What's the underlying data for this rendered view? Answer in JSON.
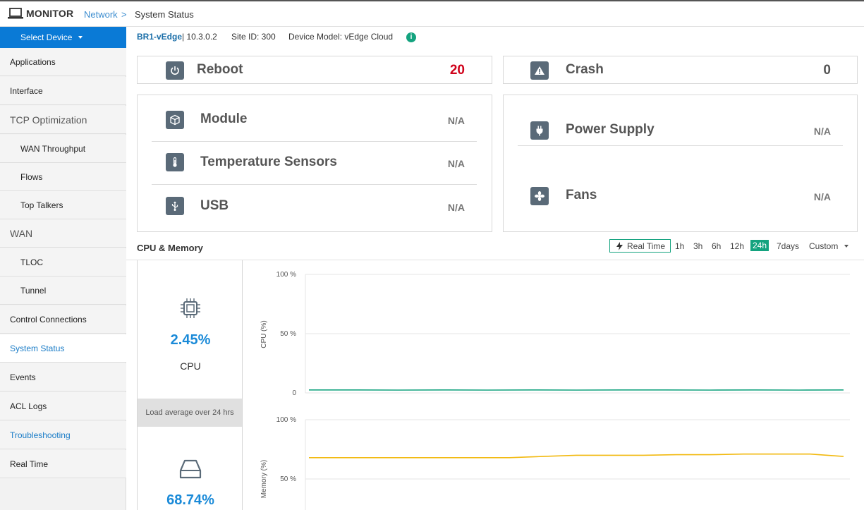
{
  "header": {
    "app_title": "MONITOR",
    "breadcrumb_link": "Network",
    "breadcrumb_sep": ">",
    "breadcrumb_current": "System Status"
  },
  "sidebar": {
    "select_device": "Select Device",
    "items": [
      {
        "label": "Applications",
        "kind": "top"
      },
      {
        "label": "Interface",
        "kind": "top"
      },
      {
        "label": "TCP Optimization",
        "kind": "group"
      },
      {
        "label": "WAN Throughput",
        "kind": "sub"
      },
      {
        "label": "Flows",
        "kind": "sub"
      },
      {
        "label": "Top Talkers",
        "kind": "sub"
      },
      {
        "label": "WAN",
        "kind": "group"
      },
      {
        "label": "TLOC",
        "kind": "sub"
      },
      {
        "label": "Tunnel",
        "kind": "sub"
      },
      {
        "label": "Control Connections",
        "kind": "top"
      },
      {
        "label": "System Status",
        "kind": "top",
        "active": true
      },
      {
        "label": "Events",
        "kind": "top"
      },
      {
        "label": "ACL Logs",
        "kind": "top"
      },
      {
        "label": "Troubleshooting",
        "kind": "top",
        "link": true
      },
      {
        "label": "Real Time",
        "kind": "top"
      }
    ]
  },
  "device": {
    "name": "BR1-vEdge",
    "version": "| 10.3.0.2",
    "site": "Site ID: 300",
    "model": "Device Model: vEdge Cloud",
    "info_icon": "i"
  },
  "cards": {
    "reboot": {
      "label": "Reboot",
      "value": "20",
      "icon": "power-icon"
    },
    "crash": {
      "label": "Crash",
      "value": "0",
      "icon": "warning-icon"
    },
    "module": {
      "label": "Module",
      "value": "N/A",
      "icon": "cube-icon"
    },
    "temperature": {
      "label": "Temperature Sensors",
      "value": "N/A",
      "icon": "thermometer-icon"
    },
    "usb": {
      "label": "USB",
      "value": "N/A",
      "icon": "usb-icon"
    },
    "power_supply": {
      "label": "Power Supply",
      "value": "N/A",
      "icon": "plug-icon"
    },
    "fans": {
      "label": "Fans",
      "value": "N/A",
      "icon": "fan-icon"
    }
  },
  "cpu_memory": {
    "title": "CPU & Memory",
    "realtime": "Real Time",
    "ranges": [
      "1h",
      "3h",
      "6h",
      "12h",
      "24h",
      "7days",
      "Custom"
    ],
    "selected_range": "24h",
    "cpu_value": "2.45%",
    "cpu_label": "CPU",
    "load_avg": "Load average over 24 hrs",
    "memory_value": "68.74%"
  },
  "chart_data": [
    {
      "type": "line",
      "ylabel": "CPU (%)",
      "ytick_labels": [
        "100 %",
        "50 %",
        "0"
      ],
      "ylim": [
        0,
        100
      ],
      "series": [
        {
          "color": "#14a37f",
          "values": [
            2.5,
            2.5,
            2.4,
            2.5,
            2.4,
            2.5,
            2.4,
            2.5,
            2.5,
            2.4,
            2.5,
            2.4,
            2.5
          ]
        }
      ]
    },
    {
      "type": "line",
      "ylabel": "Memory (%)",
      "ytick_labels": [
        "100 %",
        "50 %"
      ],
      "ylim": [
        0,
        100
      ],
      "series": [
        {
          "color": "#f2b90f",
          "values": [
            68,
            68,
            68,
            68,
            68,
            68,
            68,
            69,
            70,
            70,
            70,
            70.5,
            70.5,
            71,
            71,
            71,
            69
          ]
        }
      ]
    }
  ],
  "colors": {
    "accent": "#14a37f",
    "brand_blue": "#0a7ad6",
    "reboot_red": "#d0021b",
    "memory": "#f2b90f"
  }
}
